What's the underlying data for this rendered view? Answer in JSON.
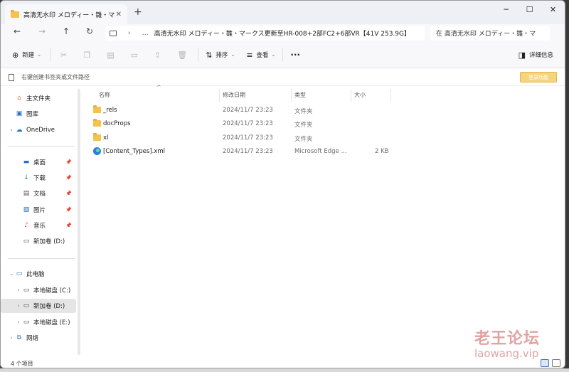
{
  "tab": {
    "title": "高清无水印 メロディー・雛・マ",
    "close": "✕",
    "new": "+"
  },
  "window_buttons": {
    "minimize": "─",
    "maximize": "☐",
    "close": "✕"
  },
  "nav": {
    "back": "←",
    "forward": "→",
    "up": "↑",
    "refresh": "↻"
  },
  "address": {
    "more": "…",
    "chevron": "›",
    "path": "高清无水印 メロディー・雛・マークス更新至HR-008+2部FC2+6部VR【41V 253.9G】"
  },
  "search": {
    "placeholder": "在 高清无水印 メロディー・雛・マ"
  },
  "toolbar": {
    "new_label": "新建",
    "sort_label": "排序",
    "view_label": "查看",
    "more": "···",
    "details_label": "详细信息"
  },
  "bookmark_bar": {
    "text": "右键创建书签夹或文件路径",
    "login_label": "登录功能"
  },
  "sidebar": {
    "items": [
      {
        "label": "主文件夹"
      },
      {
        "label": "图库"
      },
      {
        "label": "OneDrive"
      },
      {
        "label": "桌面"
      },
      {
        "label": "下载"
      },
      {
        "label": "文档"
      },
      {
        "label": "图片"
      },
      {
        "label": "音乐"
      },
      {
        "label": "新加卷 (D:)"
      },
      {
        "label": "此电脑"
      },
      {
        "label": "本地磁盘 (C:)"
      },
      {
        "label": "新加卷 (D:)"
      },
      {
        "label": "本地磁盘 (E:)"
      },
      {
        "label": "网络"
      }
    ]
  },
  "columns": {
    "name": "名称",
    "date": "修改日期",
    "type": "类型",
    "size": "大小"
  },
  "files": [
    {
      "name": "_rels",
      "date": "2024/11/7 23:23",
      "type": "文件夹",
      "size": ""
    },
    {
      "name": "docProps",
      "date": "2024/11/7 23:23",
      "type": "文件夹",
      "size": ""
    },
    {
      "name": "xl",
      "date": "2024/11/7 23:23",
      "type": "文件夹",
      "size": ""
    },
    {
      "name": "[Content_Types].xml",
      "date": "2024/11/7 23:23",
      "type": "Microsoft Edge ...",
      "size": "2 KB"
    }
  ],
  "status": {
    "count": "4 个项目"
  },
  "watermark": {
    "cn": "老王论坛",
    "en": "laowang.vip"
  }
}
